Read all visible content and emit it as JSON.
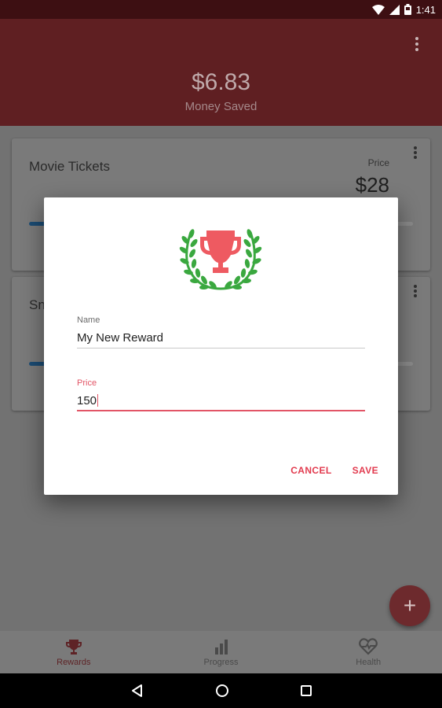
{
  "status_bar": {
    "time": "1:41",
    "icons": [
      "wifi-icon",
      "signal-icon",
      "battery-icon"
    ]
  },
  "header": {
    "money_value": "$6.83",
    "money_label": "Money Saved",
    "menu_icon": "more-vert-icon"
  },
  "cards": [
    {
      "title": "Movie Tickets",
      "price_label": "Price",
      "price": "$28",
      "progress": 0.15
    },
    {
      "title": "Sn",
      "progress": 0.15
    }
  ],
  "dialog": {
    "icon": "trophy-laurel-icon",
    "name_label": "Name",
    "name_value": "My New Reward",
    "price_label": "Price",
    "price_value": "150",
    "cancel_label": "CANCEL",
    "save_label": "SAVE"
  },
  "fab": {
    "icon": "plus-icon",
    "label": "+"
  },
  "bottom_nav": [
    {
      "label": "Rewards",
      "icon": "trophy-icon",
      "active": true
    },
    {
      "label": "Progress",
      "icon": "bar-chart-icon",
      "active": false
    },
    {
      "label": "Health",
      "icon": "heart-pulse-icon",
      "active": false
    }
  ],
  "system_nav": [
    "back-icon",
    "home-icon",
    "recents-icon"
  ],
  "colors": {
    "accent": "#e23a4e",
    "primary": "#b83a40",
    "trophy": "#ee5a61",
    "laurel": "#3aa83f",
    "progress": "#2a7bbf"
  }
}
